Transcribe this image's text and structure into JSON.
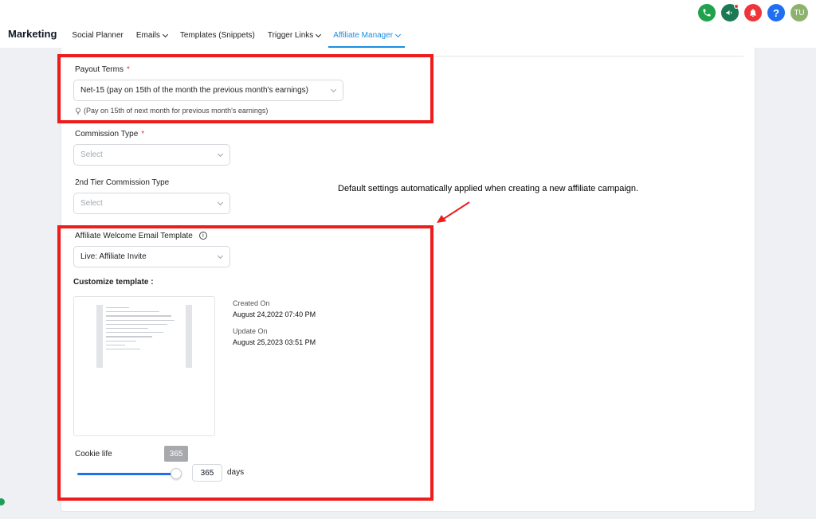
{
  "header": {
    "brand": "Marketing",
    "tabs": [
      {
        "label": "Social Planner"
      },
      {
        "label": "Emails"
      },
      {
        "label": "Templates (Snippets)"
      },
      {
        "label": "Trigger Links"
      },
      {
        "label": "Affiliate Manager"
      }
    ],
    "avatar_initials": "TU",
    "help_glyph": "?",
    "icons": [
      "phone-icon",
      "megaphone-icon",
      "bell-icon",
      "help-icon",
      "avatar"
    ]
  },
  "form": {
    "payout_terms": {
      "label": "Payout Terms",
      "required_mark": "*",
      "value": "Net-15 (pay on 15th of the month the previous month's earnings)",
      "hint": "(Pay on 15th of next month for previous month's earnings)"
    },
    "commission_type": {
      "label": "Commission Type",
      "required_mark": "*",
      "placeholder": "Select"
    },
    "second_tier": {
      "label": "2nd Tier Commission Type",
      "placeholder": "Select"
    },
    "welcome_email": {
      "label": "Affiliate Welcome Email Template",
      "value": "Live:  Affiliate Invite",
      "info_glyph": "i"
    },
    "customize": {
      "title": "Customize template :",
      "created_label": "Created On",
      "created_value": "August 24,2022 07:40 PM",
      "updated_label": "Update On",
      "updated_value": "August 25,2023 03:51 PM"
    },
    "cookie": {
      "label": "Cookie life",
      "tooltip": "365",
      "value": "365",
      "unit": "days",
      "slider_level_percent": 100
    }
  },
  "annotation": {
    "text": "Default settings automatically applied when creating a new affiliate campaign."
  },
  "colors": {
    "active_tab": "#1a8fe0",
    "highlight": "#ef1c1c",
    "slider": "#1a73e8"
  }
}
